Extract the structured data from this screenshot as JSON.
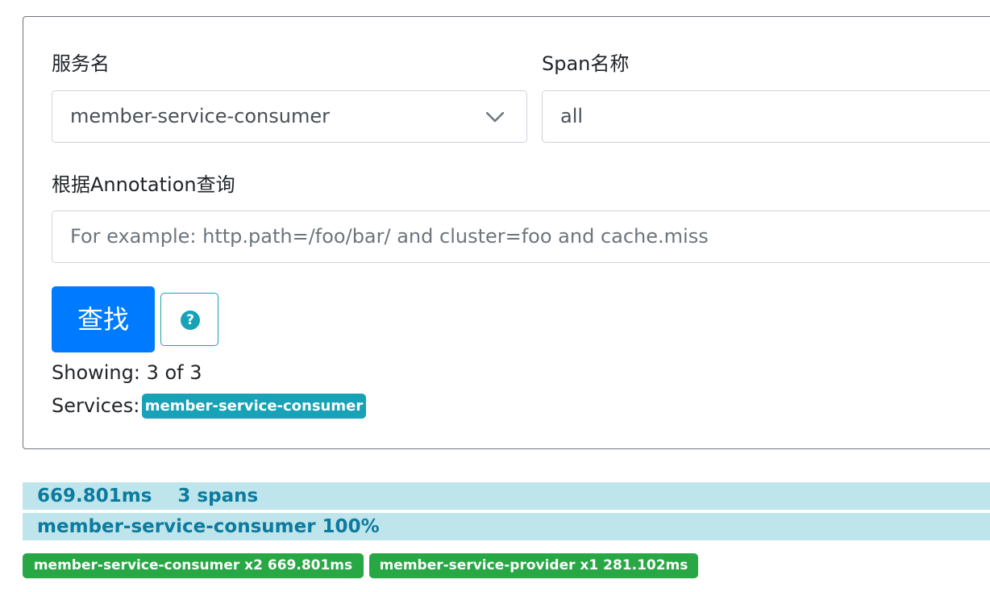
{
  "search": {
    "service_label": "服务名",
    "service_value": "member-service-consumer",
    "span_label": "Span名称",
    "span_value": "all",
    "annotation_label": "根据Annotation查询",
    "annotation_placeholder": "For example: http.path=/foo/bar/ and cluster=foo and cache.miss",
    "find_button": "查找",
    "help_icon": "?"
  },
  "results": {
    "showing_text": "Showing: 3 of 3",
    "services_label": "Services:",
    "services": [
      "member-service-consumer"
    ]
  },
  "traces": [
    {
      "duration": "669.801ms",
      "spans": "3 spans",
      "service_summary": "member-service-consumer 100%",
      "service_badges": [
        "member-service-consumer x2 669.801ms",
        "member-service-provider x1 281.102ms"
      ]
    }
  ],
  "colors": {
    "primary": "#007bff",
    "info": "#17a2b8",
    "success": "#28a745",
    "trace_bar_bg": "#bee5eb",
    "trace_bar_text": "#0c7b9f"
  }
}
